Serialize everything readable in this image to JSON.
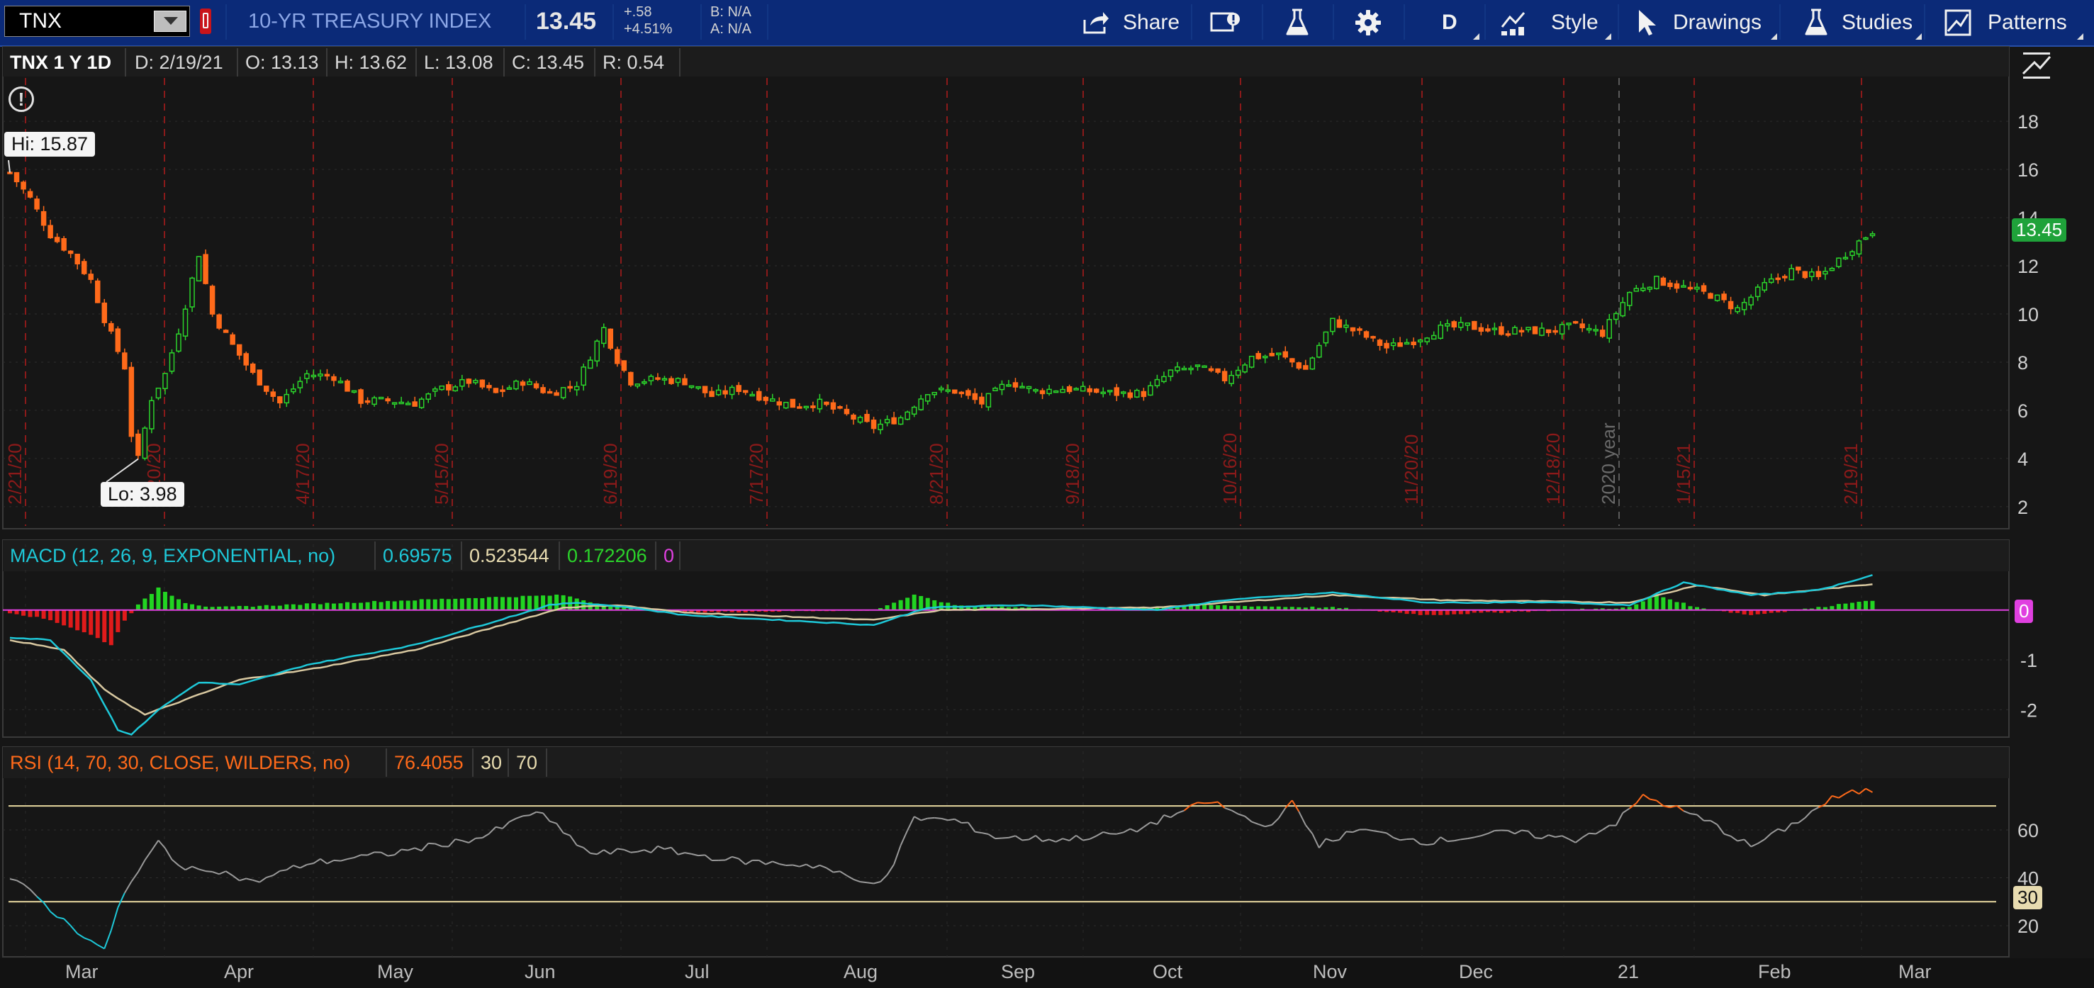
{
  "symbol": "TNX",
  "description": "10-YR TREASURY INDEX",
  "quote": {
    "last": "13.45",
    "change": "+.58",
    "change_pct": "+4.51%",
    "bid": "B: N/A",
    "ask": "A: N/A"
  },
  "toolbar": {
    "share": "Share",
    "aggregation": "D",
    "style": "Style",
    "drawings": "Drawings",
    "studies": "Studies",
    "patterns": "Patterns"
  },
  "price_header": {
    "title": "TNX 1 Y 1D",
    "date": "D: 2/19/21",
    "open": "O: 13.13",
    "high": "H: 13.62",
    "low": "L: 13.08",
    "close": "C: 13.45",
    "range": "R: 0.54"
  },
  "price_hi_label": "Hi: 15.87",
  "price_lo_label": "Lo: 3.98",
  "last_price_badge": "13.45",
  "macd_header": {
    "title": "MACD (12, 26, 9, EXPONENTIAL, no)",
    "value": "0.69575",
    "avg": "0.523544",
    "diff": "0.172206",
    "zero": "0"
  },
  "macd_zero_badge": "0",
  "rsi_header": {
    "title": "RSI (14, 70, 30, CLOSE, WILDERS, no)",
    "value": "76.4055",
    "oversold": "30",
    "overbought": "70"
  },
  "rsi_oversold_badge": "30",
  "date_axis": [
    "Mar",
    "Apr",
    "May",
    "Jun",
    "Jul",
    "Aug",
    "Sep",
    "Oct",
    "Nov",
    "Dec",
    "21",
    "Feb",
    "Mar"
  ],
  "colors": {
    "up": "#2bd42b",
    "down": "#ff6a1a",
    "macd": "#1ec8d8",
    "macd_avg": "#d8c8a0",
    "hist_up": "#22d422",
    "hist_down": "#e01b1b",
    "zero_line": "#e040e0",
    "rsi": "#9a9a9a",
    "rsi_over": "#ff6a1a",
    "rsi_bounds": "#e8d8a0",
    "week_marker": "#8b1a1a",
    "toolbar": "#0b2a78",
    "background": "#161616"
  },
  "chart_data": [
    {
      "type": "candlestick",
      "title": "TNX 1 Y 1D",
      "yticks": [
        2,
        4,
        6,
        8,
        10,
        12,
        14,
        16,
        18
      ],
      "ylim": [
        1.2,
        19.8
      ],
      "week_markers": [
        "2/21/20",
        "3/20/20",
        "4/17/20",
        "5/15/20",
        "6/19/20",
        "7/17/20",
        "8/21/20",
        "9/18/20",
        "10/16/20",
        "11/20/20",
        "12/18/20",
        "1/15/21",
        "2/19/21"
      ],
      "year_marker": "2020 year",
      "anchors": [
        [
          0,
          15.87
        ],
        [
          3,
          14.8
        ],
        [
          6,
          13.3
        ],
        [
          9,
          12.5
        ],
        [
          12,
          11.4
        ],
        [
          14,
          9.8
        ],
        [
          17,
          7.8
        ],
        [
          18,
          5.0
        ],
        [
          19,
          3.98
        ],
        [
          21,
          6.5
        ],
        [
          23,
          7.5
        ],
        [
          25,
          9.3
        ],
        [
          28,
          12.5
        ],
        [
          30,
          10.0
        ],
        [
          33,
          8.7
        ],
        [
          36,
          7.5
        ],
        [
          40,
          6.3
        ],
        [
          44,
          7.5
        ],
        [
          48,
          7.4
        ],
        [
          52,
          6.4
        ],
        [
          56,
          6.4
        ],
        [
          60,
          6.3
        ],
        [
          64,
          6.9
        ],
        [
          68,
          7.2
        ],
        [
          72,
          6.7
        ],
        [
          76,
          7.2
        ],
        [
          80,
          6.7
        ],
        [
          84,
          7.1
        ],
        [
          88,
          9.4
        ],
        [
          90,
          8.1
        ],
        [
          92,
          7.2
        ],
        [
          96,
          7.3
        ],
        [
          100,
          7.2
        ],
        [
          104,
          6.6
        ],
        [
          108,
          6.9
        ],
        [
          112,
          6.5
        ],
        [
          116,
          6.2
        ],
        [
          120,
          6.3
        ],
        [
          124,
          5.8
        ],
        [
          128,
          5.3
        ],
        [
          132,
          5.7
        ],
        [
          136,
          6.8
        ],
        [
          140,
          6.8
        ],
        [
          144,
          6.3
        ],
        [
          148,
          7.2
        ],
        [
          152,
          6.8
        ],
        [
          156,
          6.9
        ],
        [
          160,
          6.8
        ],
        [
          164,
          6.7
        ],
        [
          168,
          6.7
        ],
        [
          172,
          7.6
        ],
        [
          176,
          7.8
        ],
        [
          180,
          7.3
        ],
        [
          184,
          8.2
        ],
        [
          188,
          8.3
        ],
        [
          192,
          7.7
        ],
        [
          196,
          9.7
        ],
        [
          200,
          9.2
        ],
        [
          204,
          8.6
        ],
        [
          208,
          8.9
        ],
        [
          212,
          9.4
        ],
        [
          216,
          9.5
        ],
        [
          220,
          9.3
        ],
        [
          224,
          9.3
        ],
        [
          228,
          9.3
        ],
        [
          232,
          9.5
        ],
        [
          236,
          9.2
        ],
        [
          240,
          10.9
        ],
        [
          244,
          11.4
        ],
        [
          248,
          11.1
        ],
        [
          252,
          10.8
        ],
        [
          256,
          10.2
        ],
        [
          260,
          11.2
        ],
        [
          264,
          11.8
        ],
        [
          268,
          11.5
        ],
        [
          272,
          12.5
        ],
        [
          274,
          13.0
        ],
        [
          276,
          13.45
        ]
      ]
    },
    {
      "type": "line",
      "title": "MACD (12, 26, 9, EXPONENTIAL, no)",
      "yticks": [
        -2,
        -1,
        0
      ],
      "ylim": [
        -2.55,
        0.75
      ],
      "series": [
        {
          "name": "Value",
          "anchors": [
            [
              0,
              -0.55
            ],
            [
              6,
              -0.6
            ],
            [
              12,
              -1.4
            ],
            [
              16,
              -2.4
            ],
            [
              18,
              -2.5
            ],
            [
              22,
              -2.0
            ],
            [
              28,
              -1.45
            ],
            [
              34,
              -1.5
            ],
            [
              44,
              -1.1
            ],
            [
              60,
              -0.7
            ],
            [
              80,
              0.1
            ],
            [
              84,
              0.15
            ],
            [
              92,
              0.05
            ],
            [
              100,
              -0.1
            ],
            [
              128,
              -0.3
            ],
            [
              136,
              0.05
            ],
            [
              150,
              0.1
            ],
            [
              170,
              0.0
            ],
            [
              180,
              0.2
            ],
            [
              196,
              0.35
            ],
            [
              210,
              0.15
            ],
            [
              230,
              0.15
            ],
            [
              240,
              0.1
            ],
            [
              248,
              0.55
            ],
            [
              258,
              0.3
            ],
            [
              268,
              0.4
            ],
            [
              276,
              0.7
            ]
          ]
        },
        {
          "name": "Avg",
          "anchors": [
            [
              0,
              -0.6
            ],
            [
              8,
              -0.8
            ],
            [
              14,
              -1.6
            ],
            [
              20,
              -2.1
            ],
            [
              26,
              -1.8
            ],
            [
              34,
              -1.4
            ],
            [
              44,
              -1.2
            ],
            [
              60,
              -0.8
            ],
            [
              82,
              0.05
            ],
            [
              90,
              0.1
            ],
            [
              100,
              -0.05
            ],
            [
              128,
              -0.2
            ],
            [
              138,
              0.0
            ],
            [
              170,
              0.05
            ],
            [
              196,
              0.3
            ],
            [
              212,
              0.2
            ],
            [
              240,
              0.15
            ],
            [
              250,
              0.5
            ],
            [
              260,
              0.3
            ],
            [
              276,
              0.52
            ]
          ]
        }
      ],
      "histogram_anchors": [
        [
          0,
          -0.05
        ],
        [
          6,
          -0.2
        ],
        [
          12,
          -0.5
        ],
        [
          15,
          -0.7
        ],
        [
          17,
          -0.2
        ],
        [
          19,
          0.1
        ],
        [
          22,
          0.45
        ],
        [
          26,
          0.15
        ],
        [
          30,
          0.05
        ],
        [
          40,
          0.1
        ],
        [
          70,
          0.25
        ],
        [
          82,
          0.3
        ],
        [
          88,
          0.1
        ],
        [
          100,
          -0.05
        ],
        [
          128,
          0.0
        ],
        [
          134,
          0.3
        ],
        [
          140,
          0.1
        ],
        [
          160,
          0.0
        ],
        [
          176,
          0.1
        ],
        [
          196,
          0.05
        ],
        [
          210,
          -0.1
        ],
        [
          240,
          0.05
        ],
        [
          244,
          0.3
        ],
        [
          250,
          0.05
        ],
        [
          258,
          -0.1
        ],
        [
          268,
          0.05
        ],
        [
          274,
          0.18
        ],
        [
          276,
          0.17
        ]
      ]
    },
    {
      "type": "line",
      "title": "RSI (14, 70, 30, CLOSE, WILDERS, no)",
      "yticks": [
        20,
        40,
        60
      ],
      "ylim": [
        7,
        81
      ],
      "overbought": 70,
      "oversold": 30,
      "anchors": [
        [
          0,
          40
        ],
        [
          4,
          32
        ],
        [
          8,
          22
        ],
        [
          12,
          14
        ],
        [
          14,
          9
        ],
        [
          16,
          28
        ],
        [
          18,
          38
        ],
        [
          22,
          55
        ],
        [
          26,
          43
        ],
        [
          30,
          44
        ],
        [
          36,
          38
        ],
        [
          44,
          46
        ],
        [
          56,
          50
        ],
        [
          70,
          57
        ],
        [
          78,
          68
        ],
        [
          86,
          50
        ],
        [
          96,
          52
        ],
        [
          108,
          47
        ],
        [
          120,
          45
        ],
        [
          126,
          38
        ],
        [
          130,
          40
        ],
        [
          134,
          65
        ],
        [
          140,
          64
        ],
        [
          146,
          57
        ],
        [
          156,
          56
        ],
        [
          166,
          59
        ],
        [
          172,
          66
        ],
        [
          178,
          72
        ],
        [
          186,
          61
        ],
        [
          190,
          71
        ],
        [
          194,
          54
        ],
        [
          200,
          60
        ],
        [
          210,
          55
        ],
        [
          222,
          59
        ],
        [
          232,
          56
        ],
        [
          238,
          63
        ],
        [
          242,
          74
        ],
        [
          246,
          70
        ],
        [
          252,
          63
        ],
        [
          258,
          53
        ],
        [
          264,
          62
        ],
        [
          270,
          73
        ],
        [
          274,
          76
        ],
        [
          276,
          76.4
        ]
      ]
    }
  ]
}
